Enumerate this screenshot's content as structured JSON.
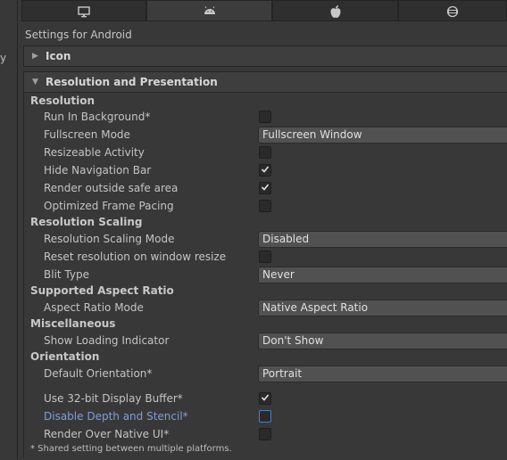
{
  "left_cut_text": "y",
  "tabs": [
    {
      "name": "standalone",
      "icon": "monitor-icon"
    },
    {
      "name": "android",
      "icon": "android-icon"
    },
    {
      "name": "ios",
      "icon": "apple-icon"
    },
    {
      "name": "webgl",
      "icon": "webgl-icon"
    }
  ],
  "settings_title": "Settings for Android",
  "icon_section": {
    "label": "Icon",
    "expanded": false
  },
  "resolution_section": {
    "label": "Resolution and Presentation",
    "expanded": true
  },
  "headers": {
    "resolution": "Resolution",
    "scaling": "Resolution Scaling",
    "aspect": "Supported Aspect Ratio",
    "misc": "Miscellaneous",
    "orientation": "Orientation"
  },
  "rows": {
    "run_in_background": {
      "label": "Run In Background*",
      "checked": false
    },
    "fullscreen_mode": {
      "label": "Fullscreen Mode",
      "value": "Fullscreen Window"
    },
    "resizeable_activity": {
      "label": "Resizeable Activity",
      "checked": false
    },
    "hide_nav_bar": {
      "label": "Hide Navigation Bar",
      "checked": true
    },
    "render_outside_safe": {
      "label": "Render outside safe area",
      "checked": true
    },
    "optimized_frame_pacing": {
      "label": "Optimized Frame Pacing",
      "checked": false
    },
    "scaling_mode": {
      "label": "Resolution Scaling Mode",
      "value": "Disabled"
    },
    "reset_resolution": {
      "label": "Reset resolution on window resize",
      "checked": false
    },
    "blit_type": {
      "label": "Blit Type",
      "value": "Never"
    },
    "aspect_mode": {
      "label": "Aspect Ratio Mode",
      "value": "Native Aspect Ratio"
    },
    "loading_indicator": {
      "label": "Show Loading Indicator",
      "value": "Don't Show"
    },
    "default_orientation": {
      "label": "Default Orientation*",
      "value": "Portrait"
    },
    "use_32bit": {
      "label": "Use 32-bit Display Buffer*",
      "checked": true
    },
    "disable_depth": {
      "label": "Disable Depth and Stencil*",
      "checked": false
    },
    "render_over_native": {
      "label": "Render Over Native UI*",
      "checked": false
    }
  },
  "footnote": "* Shared setting between multiple platforms.",
  "colors": {
    "accent_focus": "#4a7fc9",
    "highlight_label": "#7d9fd8",
    "background": "#383838"
  }
}
